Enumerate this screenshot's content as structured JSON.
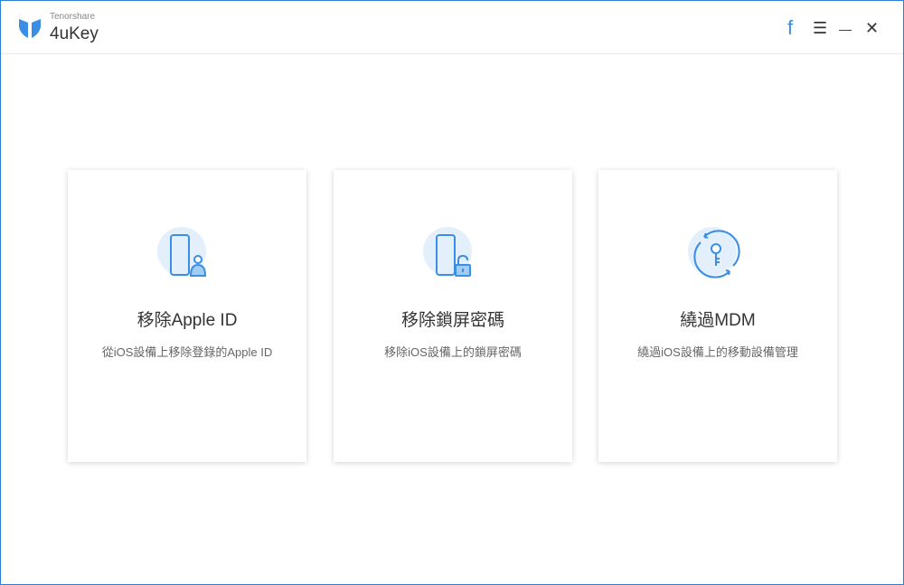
{
  "header": {
    "company": "Tenorshare",
    "product": "4uKey"
  },
  "controls": {
    "facebook": "f",
    "menu": "☰",
    "minimize": "—",
    "close": "✕"
  },
  "cards": [
    {
      "title": "移除Apple ID",
      "desc": "從iOS設備上移除登錄的Apple ID",
      "icon": "phone-user-icon"
    },
    {
      "title": "移除鎖屏密碼",
      "desc": "移除iOS設備上的鎖屏密碼",
      "icon": "phone-lock-icon"
    },
    {
      "title": "繞過MDM",
      "desc": "繞過iOS設備上的移動設備管理",
      "icon": "key-cycle-icon"
    }
  ],
  "colors": {
    "accent": "#3a8ee6",
    "iconBg": "#e3f0fc",
    "border": "#2b7fd8"
  }
}
